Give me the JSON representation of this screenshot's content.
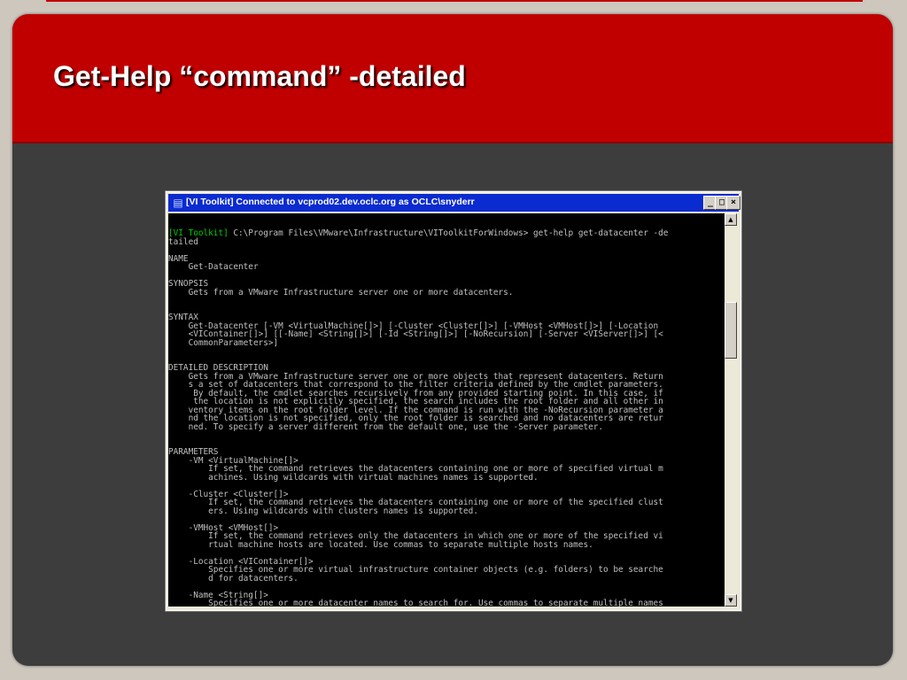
{
  "slide": {
    "title": "Get-Help “command” -detailed"
  },
  "window": {
    "title": "[VI Toolkit] Connected to vcprod02.dev.oclc.org as OCLC\\snyderr",
    "minimize_label": "_",
    "maximize_label": "□",
    "close_label": "×",
    "icon": "console-window-icon"
  },
  "console": {
    "prompt_tag": "[VI Toolkit]",
    "prompt_command": " C:\\Program Files\\VMware\\Infrastructure\\VIToolkitForWindows> get-help get-datacenter -de",
    "lines": [
      "tailed",
      "",
      "NAME",
      "    Get-Datacenter",
      "",
      "SYNOPSIS",
      "    Gets from a VMware Infrastructure server one or more datacenters.",
      "",
      "",
      "SYNTAX",
      "    Get-Datacenter [-VM <VirtualMachine[]>] [-Cluster <Cluster[]>] [-VMHost <VMHost[]>] [-Location",
      "    <VIContainer[]>] [[-Name] <String[]>] [-Id <String[]>] [-NoRecursion] [-Server <VIServer[]>] [<",
      "    CommonParameters>]",
      "",
      "",
      "DETAILED DESCRIPTION",
      "    Gets from a VMware Infrastructure server one or more objects that represent datacenters. Return",
      "    s a set of datacenters that correspond to the filter criteria defined by the cmdlet parameters.",
      "     By default, the cmdlet searches recursively from any provided starting point. In this case, if",
      "     the location is not explicitly specified, the search includes the root folder and all other in",
      "    ventory items on the root folder level. If the command is run with the -NoRecursion parameter a",
      "    nd the location is not specified, only the root folder is searched and no datacenters are retur",
      "    ned. To specify a server different from the default one, use the -Server parameter.",
      "",
      "",
      "PARAMETERS",
      "    -VM <VirtualMachine[]>",
      "        If set, the command retrieves the datacenters containing one or more of specified virtual m",
      "        achines. Using wildcards with virtual machines names is supported.",
      "",
      "    -Cluster <Cluster[]>",
      "        If set, the command retrieves the datacenters containing one or more of the specified clust",
      "        ers. Using wildcards with clusters names is supported.",
      "",
      "    -VMHost <VMHost[]>",
      "        If set, the command retrieves only the datacenters in which one or more of the specified vi",
      "        rtual machine hosts are located. Use commas to separate multiple hosts names.",
      "",
      "    -Location <VIContainer[]>",
      "        Specifies one or more virtual infrastructure container objects (e.g. folders) to be searche",
      "        d for datacenters.",
      "",
      "    -Name <String[]>",
      "        Specifies one or more datacenter names to search for. Use commas to separate multiple names"
    ]
  },
  "colors": {
    "title_band": "#c00000",
    "slide_background": "#3d3d3d",
    "console_background": "#000000",
    "console_text": "#c0c0c0",
    "prompt_tag": "#00d000",
    "window_titlebar": "#0a2bd0"
  }
}
